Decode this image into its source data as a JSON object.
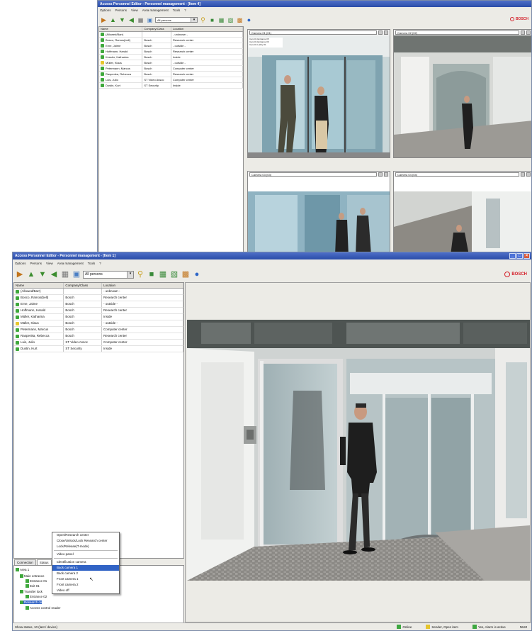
{
  "back_window": {
    "title": "Access Personnel Editor - Personnel management - [Item 4]",
    "menu": [
      "Options",
      "Persons",
      "View",
      "Area management",
      "Tools",
      "?"
    ],
    "persons_combo": "All persons",
    "columns": [
      "Name",
      "Company/Class",
      "Location"
    ],
    "rows": [
      {
        "name": "(Allowed/Barr)",
        "company": "",
        "location": "- unknown -",
        "flag": "g"
      },
      {
        "name": "Bosco, Ramos(bell)",
        "company": "Bosch",
        "location": "Research center",
        "flag": "g"
      },
      {
        "name": "Erne, Jaime",
        "company": "Bosch",
        "location": "- outside -",
        "flag": "g"
      },
      {
        "name": "Hoffmann, Harald",
        "company": "Bosch",
        "location": "Research center",
        "flag": "g"
      },
      {
        "name": "Kessler, Katharina",
        "company": "Bosch",
        "location": "Inside",
        "flag": "g"
      },
      {
        "name": "Müller, Klaus",
        "company": "Bosch",
        "location": "- outside -",
        "flag": "y"
      },
      {
        "name": "Petermann, Marcus",
        "company": "Bosch",
        "location": "Computer center",
        "flag": "g"
      },
      {
        "name": "Raspenka, Rebecca",
        "company": "Bosch",
        "location": "Research center",
        "flag": "g"
      },
      {
        "name": "Luis, Julio",
        "company": "ST Video Assoc",
        "location": "Computer center",
        "flag": "g"
      },
      {
        "name": "Dustin, Kurt",
        "company": "ST Security",
        "location": "Inside",
        "flag": "g"
      }
    ],
    "video_sources": [
      "Camera 01 (01)",
      "Camera 02 (02)",
      "Camera 03 (03)",
      "Camera 04 (04)"
    ],
    "overlay_lines": [
      "Cam 01 Entrance 05",
      "Cam 01 Entrance 06",
      "Cam 01 Lobby 01"
    ]
  },
  "front_window": {
    "title": "Access Personnel Editor - Personnel management - [Item 1]",
    "menu": [
      "Options",
      "Persons",
      "View",
      "Area management",
      "Tools",
      "?"
    ],
    "persons_combo": "All persons",
    "brand": "BOSCH",
    "columns": [
      "Name",
      "Company/Class",
      "Location"
    ],
    "rows": [
      {
        "name": "(Allowed/Barr)",
        "company": "",
        "location": "- unknown -",
        "flag": "g"
      },
      {
        "name": "Bosco, Ramos(bell)",
        "company": "Bosch",
        "location": "Research center",
        "flag": "g"
      },
      {
        "name": "Erne, Jaime",
        "company": "Bosch",
        "location": "- outside -",
        "flag": "g"
      },
      {
        "name": "Hoffmann, Harald",
        "company": "Bosch",
        "location": "Research center",
        "flag": "g"
      },
      {
        "name": "Müller, Katharina",
        "company": "Bosch",
        "location": "Inside",
        "flag": "g"
      },
      {
        "name": "Müller, Klaus",
        "company": "Bosch",
        "location": "- outside -",
        "flag": "y"
      },
      {
        "name": "Petermann, Marcus",
        "company": "Bosch",
        "location": "Computer center",
        "flag": "g"
      },
      {
        "name": "Raspenka, Rebecca",
        "company": "Bosch",
        "location": "Research center",
        "flag": "g"
      },
      {
        "name": "Luis, Julio",
        "company": "ST Video Assoc",
        "location": "Computer center",
        "flag": "g"
      },
      {
        "name": "Dustin, Kurt",
        "company": "ST Security",
        "location": "Inside",
        "flag": "g"
      }
    ],
    "tabs": [
      "Connection",
      "Status"
    ],
    "tree": [
      "Area 1",
      "Main entrance",
      "Entrance 01",
      "Exit 01",
      "Transfer lock",
      "Entrance 02",
      "Research ce",
      "Access control reader"
    ],
    "context_menu": [
      {
        "label": "Open/Research center",
        "sep": false
      },
      {
        "label": "Close/Unlock/Lock Research center",
        "sep": false
      },
      {
        "label": "Lock/Release(T-mode)",
        "sep": true
      },
      {
        "label": "Video panel",
        "sep": true
      },
      {
        "label": "Identification camera",
        "sep": false
      },
      {
        "label": "Back camera 1",
        "sep": false,
        "sel": true
      },
      {
        "label": "Back camera 2",
        "sep": false
      },
      {
        "label": "Front camera 1",
        "sep": false
      },
      {
        "label": "Front camera 2",
        "sep": false
      },
      {
        "label": "Video off",
        "sep": false
      }
    ],
    "status_left": "Show status, 10 (last / device)",
    "status_items": [
      "Online",
      "Sender, Open item",
      "Yes, Alarm is active"
    ],
    "status_right": "NUM"
  },
  "colors": {
    "title": "#2a4ca8",
    "brand": "#d4202a",
    "status_green": "#3ea840"
  }
}
